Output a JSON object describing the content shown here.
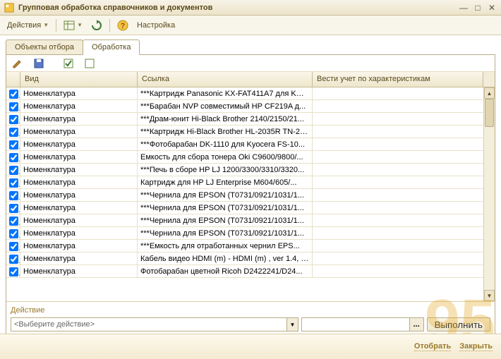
{
  "window": {
    "title": "Групповая обработка справочников и документов"
  },
  "toolbar": {
    "actions_label": "Действия",
    "settings_label": "Настройка"
  },
  "tabs": {
    "selection": "Объекты отбора",
    "processing": "Обработка"
  },
  "grid": {
    "columns": {
      "type": "Вид",
      "link": "Ссылка",
      "accounting": "Вести учет по характеристикам"
    },
    "rows": [
      {
        "checked": true,
        "type": "Номенклатура",
        "link": "***Картридж Panasonic KX-FAT411A7 для KX-..."
      },
      {
        "checked": true,
        "type": "Номенклатура",
        "link": "***Барабан NVP совместимый HP CF219A д..."
      },
      {
        "checked": true,
        "type": "Номенклатура",
        "link": "***Драм-юнит Hi-Black Brother 2140/2150/21..."
      },
      {
        "checked": true,
        "type": "Номенклатура",
        "link": "***Картридж Hi-Black Brother HL-2035R TN-20..."
      },
      {
        "checked": true,
        "type": "Номенклатура",
        "link": "***Фотобарабан DK-1110 для Kyocera  FS-10..."
      },
      {
        "checked": true,
        "type": "Номенклатура",
        "link": "Емкость для сбора тонера Oki C9600/9800/..."
      },
      {
        "checked": true,
        "type": "Номенклатура",
        "link": "***Печь в сборе HP LJ 1200/3300/3310/3320..."
      },
      {
        "checked": true,
        "type": "Номенклатура",
        "link": "Картридж для HP LJ Enterprise M604/605/..."
      },
      {
        "checked": true,
        "type": "Номенклатура",
        "link": "***Чернила для EPSON (T0731/0921/1031/1..."
      },
      {
        "checked": true,
        "type": "Номенклатура",
        "link": "***Чернила для EPSON (T0731/0921/1031/1..."
      },
      {
        "checked": true,
        "type": "Номенклатура",
        "link": "***Чернила для EPSON (T0731/0921/1031/1..."
      },
      {
        "checked": true,
        "type": "Номенклатура",
        "link": "***Чернила для EPSON (T0731/0921/1031/1..."
      },
      {
        "checked": true,
        "type": "Номенклатура",
        "link": "***Емкость для отработанных чернил EPS..."
      },
      {
        "checked": true,
        "type": "Номенклатура",
        "link": "Кабель видео HDMI (m) - HDMI (m) , ver 1.4, 1..."
      },
      {
        "checked": true,
        "type": "Номенклатура",
        "link": "Фотобарабан цветной Ricoh  D2422241/D24..."
      }
    ]
  },
  "action": {
    "section_label": "Действие",
    "placeholder": "<Выберите действие>",
    "execute": "Выполнить"
  },
  "bottom": {
    "select": "Отобрать",
    "close": "Закрыть"
  },
  "watermark": "95"
}
